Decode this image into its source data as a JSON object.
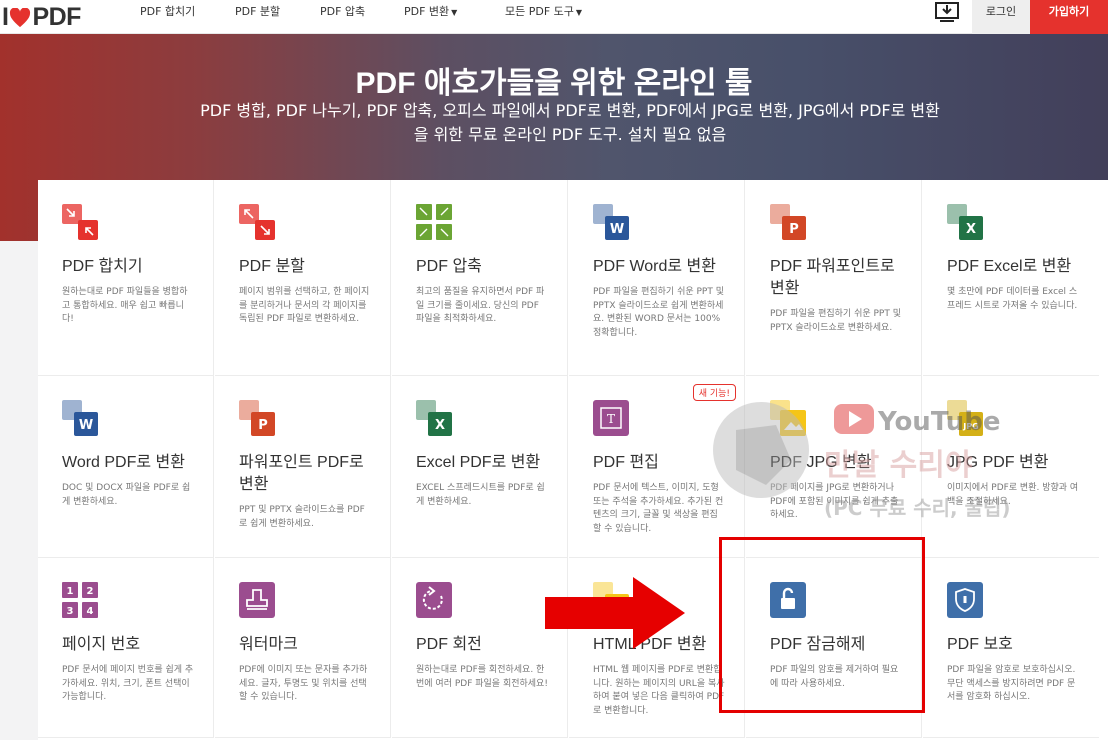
{
  "nav": {
    "logo_i": "I",
    "logo_pdf": "PDF",
    "merge": "PDF 합치기",
    "split": "PDF 분할",
    "compress": "PDF 압축",
    "convert": "PDF 변환",
    "all_tools": "모든 PDF 도구",
    "login": "로그인",
    "signup": "가입하기",
    "download_icon": "download-icon"
  },
  "hero": {
    "title": "PDF 애호가들을 위한 온라인 툴",
    "subtitle": "PDF 병합, PDF 나누기, PDF 압축, 오피스 파일에서 PDF로 변환, PDF에서 JPG로 변환, JPG에서 PDF로 변환을 위한 무료 온라인 PDF 도구. 설치 필요 없음"
  },
  "tools": [
    {
      "id": "merge",
      "title": "PDF 합치기",
      "desc": "원하는대로 PDF 파일들을 병합하고 통합하세요. 매우 쉽고 빠릅니다!",
      "color": "#e5322d",
      "icon": "merge-icon"
    },
    {
      "id": "split",
      "title": "PDF 분할",
      "desc": "페이지 범위를 선택하고, 한 페이지를 분리하거나 문서의 각 페이지를 독립된 PDF 파일로 변환하세요.",
      "color": "#e5322d",
      "icon": "split-icon"
    },
    {
      "id": "compress",
      "title": "PDF 압축",
      "desc": "최고의 품질을 유지하면서 PDF 파일 크기를 줄이세요. 당신의 PDF 파일을 최적화하세요.",
      "color": "#6ba534",
      "icon": "compress-icon"
    },
    {
      "id": "pdf-word",
      "title": "PDF Word로 변환",
      "desc": "PDF 파일을 편집하기 쉬운 PPT 및 PPTX 슬라이드쇼로 쉽게 변환하세요. 변환된 WORD 문서는 100% 정확합니다.",
      "color": "#2b579a",
      "letter": "W",
      "icon": "word-icon"
    },
    {
      "id": "pdf-ppt",
      "title": "PDF 파워포인트로 변환",
      "desc": "PDF 파일을 편집하기 쉬운 PPT 및 PPTX 슬라이드쇼로 변환하세요.",
      "color": "#d24726",
      "letter": "P",
      "icon": "powerpoint-icon"
    },
    {
      "id": "pdf-excel",
      "title": "PDF Excel로 변환",
      "desc": "몇 초만에 PDF 데이터를 Excel 스프레드 시트로 가져올 수 있습니다.",
      "color": "#217346",
      "letter": "X",
      "icon": "excel-icon"
    },
    {
      "id": "word-pdf",
      "title": "Word PDF로 변환",
      "desc": "DOC 및 DOCX 파일을 PDF로 쉽게 변환하세요.",
      "color": "#2b579a",
      "letter": "W",
      "icon": "word-icon"
    },
    {
      "id": "ppt-pdf",
      "title": "파워포인트 PDF로 변환",
      "desc": "PPT 및 PPTX 슬라이드쇼를 PDF로 쉽게 변환하세요.",
      "color": "#d24726",
      "letter": "P",
      "icon": "powerpoint-icon"
    },
    {
      "id": "excel-pdf",
      "title": "Excel PDF로 변환",
      "desc": "EXCEL 스프레드시트를 PDF로 쉽게 변환하세요.",
      "color": "#217346",
      "letter": "X",
      "icon": "excel-icon"
    },
    {
      "id": "edit",
      "title": "PDF 편집",
      "desc": "PDF 문서에 텍스트, 이미지, 도형 또는 주석을 추가하세요. 추가된 컨텐츠의 크기, 글꼴 및 색상을 편집할 수 있습니다.",
      "color": "#9b4d8f",
      "badge": "새 기능!",
      "icon": "edit-icon"
    },
    {
      "id": "pdf-jpg",
      "title": "PDF JPG 변환",
      "desc": "PDF 페이지를 JPG로 변환하거나 PDF에 포함된 이미지를 쉽게 추출하세요.",
      "color": "#f5c518",
      "icon": "jpg-icon"
    },
    {
      "id": "jpg-pdf",
      "title": "JPG PDF 변환",
      "desc": "이미지에서 PDF로 변환. 방향과 여백을 조절하세요.",
      "color": "#d4b017",
      "letter": "JPG",
      "icon": "jpg-icon"
    },
    {
      "id": "page-numbers",
      "title": "페이지 번호",
      "desc": "PDF 문서에 페이지 번호를 쉽게 추가하세요. 위치, 크기, 폰트 선택이 가능합니다.",
      "color": "#9b4d8f",
      "numbers": [
        "1",
        "2",
        "3",
        "4"
      ],
      "icon": "page-numbers-icon"
    },
    {
      "id": "watermark",
      "title": "워터마크",
      "desc": "PDF에 이미지 또는 문자를 추가하세요. 글자, 투명도 및 위치를 선택할 수 있습니다.",
      "color": "#9b4d8f",
      "icon": "stamp-icon"
    },
    {
      "id": "rotate",
      "title": "PDF 회전",
      "desc": "원하는대로 PDF를 회전하세요. 한 번에 여러 PDF 파일을 회전하세요!",
      "color": "#9b4d8f",
      "icon": "rotate-icon"
    },
    {
      "id": "html-pdf",
      "title": "HTML PDF 변환",
      "desc": "HTML 웹 페이지를 PDF로 변환합니다. 원하는 페이지의 URL을 복사하여 붙여 넣은 다음 클릭하여 PDF로 변환합니다.",
      "color": "#f5c518",
      "letter": "HTML",
      "icon": "html-icon"
    },
    {
      "id": "unlock",
      "title": "PDF 잠금해제",
      "desc": "PDF 파일의 암호를 제거하여 필요에 따라 사용하세요.",
      "color": "#3f6fa9",
      "icon": "unlock-icon"
    },
    {
      "id": "protect",
      "title": "PDF 보호",
      "desc": "PDF 파일을 암호로 보호하십시오. 무단 액세스를 방지하려면 PDF 문서를 암호화 하십시오.",
      "color": "#3f6fa9",
      "icon": "shield-icon"
    }
  ],
  "overlay": {
    "youtube": "YouTube",
    "channel": "만날 수리야",
    "channel_sub": "(PC 무료 수리, 꿀팁)",
    "badge_pc": "PC"
  }
}
